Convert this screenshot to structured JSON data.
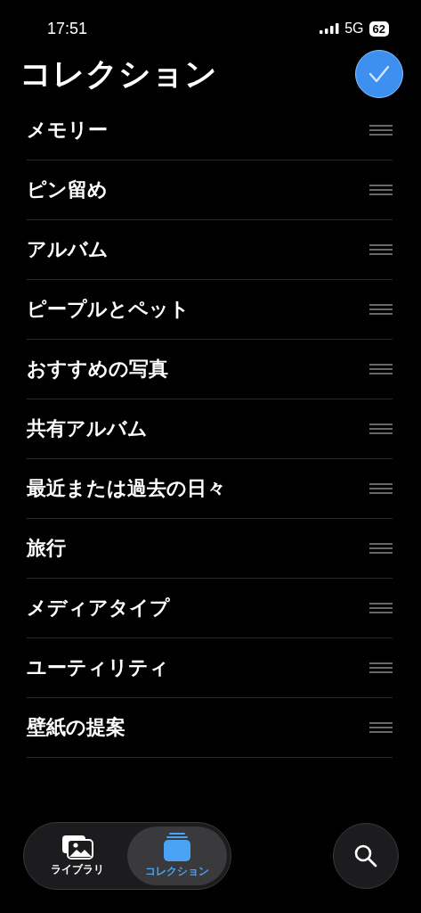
{
  "status_bar": {
    "time": "17:51",
    "network": "5G",
    "battery": "62"
  },
  "title": "コレクション",
  "items": [
    {
      "label": "メモリー"
    },
    {
      "label": "ピン留め"
    },
    {
      "label": "アルバム"
    },
    {
      "label": "ピープルとペット"
    },
    {
      "label": "おすすめの写真"
    },
    {
      "label": "共有アルバム"
    },
    {
      "label": "最近または過去の日々"
    },
    {
      "label": "旅行"
    },
    {
      "label": "メディアタイプ"
    },
    {
      "label": "ユーティリティ"
    },
    {
      "label": "壁紙の提案"
    }
  ],
  "tabs": [
    {
      "label": "ライブラリ",
      "selected": false,
      "kind": "library"
    },
    {
      "label": "コレクション",
      "selected": true,
      "kind": "collections"
    }
  ]
}
